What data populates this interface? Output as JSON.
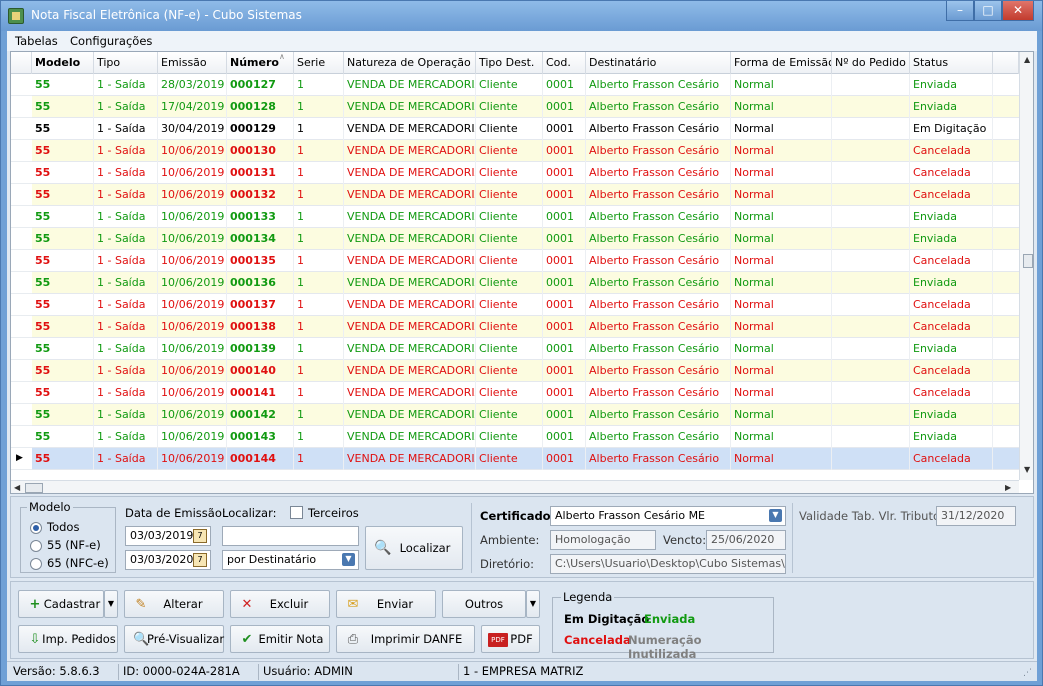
{
  "window": {
    "title": "Nota Fiscal Eletrônica (NF-e) - Cubo Sistemas",
    "min": "–",
    "max": "□",
    "close": "✕"
  },
  "menu": [
    "Tabelas",
    "Configurações"
  ],
  "grid": {
    "columns": [
      "Modelo",
      "Tipo",
      "Emissão",
      "Número",
      "Serie",
      "Natureza de Operação",
      "Tipo Dest.",
      "Cod.",
      "Destinatário",
      "Forma de Emissão",
      "Nº do Pedido",
      "Status"
    ],
    "sort_indicator": "∧",
    "rows": [
      {
        "modelo": "55",
        "tipo": "1 - Saída",
        "emissao": "28/03/2019",
        "numero": "000127",
        "serie": "1",
        "natureza": "VENDA DE MERCADORIA",
        "tipo_dest": "Cliente",
        "cod": "0001",
        "destinatario": "Alberto Frasson Cesário",
        "forma": "Normal",
        "pedido": "",
        "status": "Enviada"
      },
      {
        "modelo": "55",
        "tipo": "1 - Saída",
        "emissao": "17/04/2019",
        "numero": "000128",
        "serie": "1",
        "natureza": "VENDA DE MERCADORIA",
        "tipo_dest": "Cliente",
        "cod": "0001",
        "destinatario": "Alberto Frasson Cesário",
        "forma": "Normal",
        "pedido": "",
        "status": "Enviada"
      },
      {
        "modelo": "55",
        "tipo": "1 - Saída",
        "emissao": "30/04/2019",
        "numero": "000129",
        "serie": "1",
        "natureza": "VENDA DE MERCADORIA",
        "tipo_dest": "Cliente",
        "cod": "0001",
        "destinatario": "Alberto Frasson Cesário",
        "forma": "Normal",
        "pedido": "",
        "status": "Em Digitação"
      },
      {
        "modelo": "55",
        "tipo": "1 - Saída",
        "emissao": "10/06/2019",
        "numero": "000130",
        "serie": "1",
        "natureza": "VENDA DE MERCADORIA",
        "tipo_dest": "Cliente",
        "cod": "0001",
        "destinatario": "Alberto Frasson Cesário",
        "forma": "Normal",
        "pedido": "",
        "status": "Cancelada"
      },
      {
        "modelo": "55",
        "tipo": "1 - Saída",
        "emissao": "10/06/2019",
        "numero": "000131",
        "serie": "1",
        "natureza": "VENDA DE MERCADORIA",
        "tipo_dest": "Cliente",
        "cod": "0001",
        "destinatario": "Alberto Frasson Cesário",
        "forma": "Normal",
        "pedido": "",
        "status": "Cancelada"
      },
      {
        "modelo": "55",
        "tipo": "1 - Saída",
        "emissao": "10/06/2019",
        "numero": "000132",
        "serie": "1",
        "natureza": "VENDA DE MERCADORIA",
        "tipo_dest": "Cliente",
        "cod": "0001",
        "destinatario": "Alberto Frasson Cesário",
        "forma": "Normal",
        "pedido": "",
        "status": "Cancelada"
      },
      {
        "modelo": "55",
        "tipo": "1 - Saída",
        "emissao": "10/06/2019",
        "numero": "000133",
        "serie": "1",
        "natureza": "VENDA DE MERCADORIA",
        "tipo_dest": "Cliente",
        "cod": "0001",
        "destinatario": "Alberto Frasson Cesário",
        "forma": "Normal",
        "pedido": "",
        "status": "Enviada"
      },
      {
        "modelo": "55",
        "tipo": "1 - Saída",
        "emissao": "10/06/2019",
        "numero": "000134",
        "serie": "1",
        "natureza": "VENDA DE MERCADORIA",
        "tipo_dest": "Cliente",
        "cod": "0001",
        "destinatario": "Alberto Frasson Cesário",
        "forma": "Normal",
        "pedido": "",
        "status": "Enviada"
      },
      {
        "modelo": "55",
        "tipo": "1 - Saída",
        "emissao": "10/06/2019",
        "numero": "000135",
        "serie": "1",
        "natureza": "VENDA DE MERCADORIA",
        "tipo_dest": "Cliente",
        "cod": "0001",
        "destinatario": "Alberto Frasson Cesário",
        "forma": "Normal",
        "pedido": "",
        "status": "Cancelada"
      },
      {
        "modelo": "55",
        "tipo": "1 - Saída",
        "emissao": "10/06/2019",
        "numero": "000136",
        "serie": "1",
        "natureza": "VENDA DE MERCADORIA",
        "tipo_dest": "Cliente",
        "cod": "0001",
        "destinatario": "Alberto Frasson Cesário",
        "forma": "Normal",
        "pedido": "",
        "status": "Enviada"
      },
      {
        "modelo": "55",
        "tipo": "1 - Saída",
        "emissao": "10/06/2019",
        "numero": "000137",
        "serie": "1",
        "natureza": "VENDA DE MERCADORIA",
        "tipo_dest": "Cliente",
        "cod": "0001",
        "destinatario": "Alberto Frasson Cesário",
        "forma": "Normal",
        "pedido": "",
        "status": "Cancelada"
      },
      {
        "modelo": "55",
        "tipo": "1 - Saída",
        "emissao": "10/06/2019",
        "numero": "000138",
        "serie": "1",
        "natureza": "VENDA DE MERCADORIA",
        "tipo_dest": "Cliente",
        "cod": "0001",
        "destinatario": "Alberto Frasson Cesário",
        "forma": "Normal",
        "pedido": "",
        "status": "Cancelada"
      },
      {
        "modelo": "55",
        "tipo": "1 - Saída",
        "emissao": "10/06/2019",
        "numero": "000139",
        "serie": "1",
        "natureza": "VENDA DE MERCADORIA",
        "tipo_dest": "Cliente",
        "cod": "0001",
        "destinatario": "Alberto Frasson Cesário",
        "forma": "Normal",
        "pedido": "",
        "status": "Enviada"
      },
      {
        "modelo": "55",
        "tipo": "1 - Saída",
        "emissao": "10/06/2019",
        "numero": "000140",
        "serie": "1",
        "natureza": "VENDA DE MERCADORIA",
        "tipo_dest": "Cliente",
        "cod": "0001",
        "destinatario": "Alberto Frasson Cesário",
        "forma": "Normal",
        "pedido": "",
        "status": "Cancelada"
      },
      {
        "modelo": "55",
        "tipo": "1 - Saída",
        "emissao": "10/06/2019",
        "numero": "000141",
        "serie": "1",
        "natureza": "VENDA DE MERCADORIA",
        "tipo_dest": "Cliente",
        "cod": "0001",
        "destinatario": "Alberto Frasson Cesário",
        "forma": "Normal",
        "pedido": "",
        "status": "Cancelada"
      },
      {
        "modelo": "55",
        "tipo": "1 - Saída",
        "emissao": "10/06/2019",
        "numero": "000142",
        "serie": "1",
        "natureza": "VENDA DE MERCADORIA",
        "tipo_dest": "Cliente",
        "cod": "0001",
        "destinatario": "Alberto Frasson Cesário",
        "forma": "Normal",
        "pedido": "",
        "status": "Enviada"
      },
      {
        "modelo": "55",
        "tipo": "1 - Saída",
        "emissao": "10/06/2019",
        "numero": "000143",
        "serie": "1",
        "natureza": "VENDA DE MERCADORIA",
        "tipo_dest": "Cliente",
        "cod": "0001",
        "destinatario": "Alberto Frasson Cesário",
        "forma": "Normal",
        "pedido": "",
        "status": "Enviada"
      },
      {
        "modelo": "55",
        "tipo": "1 - Saída",
        "emissao": "10/06/2019",
        "numero": "000144",
        "serie": "1",
        "natureza": "VENDA DE MERCADORIA",
        "tipo_dest": "Cliente",
        "cod": "0001",
        "destinatario": "Alberto Frasson Cesário",
        "forma": "Normal",
        "pedido": "",
        "status": "Cancelada"
      }
    ],
    "selected_row": 17,
    "row_pointer": "▶"
  },
  "filters": {
    "modelo_label": "Modelo",
    "modelo_options": [
      "Todos",
      "55 (NF-e)",
      "65 (NFC-e)"
    ],
    "data_emissao_label": "Data de Emissão:",
    "date_from": "03/03/2019",
    "date_to": "03/03/2020",
    "localizar_label": "Localizar:",
    "localizar_value": "",
    "terceiros_label": "Terceiros",
    "localizar_por": "por Destinatário",
    "localizar_button": "Localizar",
    "certificado_label": "Certificado:",
    "certificado_value": "Alberto Frasson Cesário ME",
    "ambiente_label": "Ambiente:",
    "ambiente_value": "Homologação",
    "vencto_label": "Vencto:",
    "vencto_value": "25/06/2020",
    "diretorio_label": "Diretório:",
    "diretorio_value": "C:\\Users\\Usuario\\Desktop\\Cubo Sistemas\\NFe E",
    "validade_label": "Validade Tab. Vlr. Tributos:",
    "validade_value": "31/12/2020"
  },
  "toolbar": {
    "cadastrar": "Cadastrar",
    "alterar": "Alterar",
    "excluir": "Excluir",
    "enviar": "Enviar",
    "outros": "Outros",
    "imp_pedidos": "Imp. Pedidos",
    "pre_visualizar": "Pré-Visualizar",
    "emitir_nota": "Emitir Nota",
    "imprimir_danfe": "Imprimir DANFE",
    "pdf": "PDF",
    "pdf_icon_text": "PDF"
  },
  "legend": {
    "title": "Legenda",
    "em_digitacao": "Em Digitação",
    "enviada": "Enviada",
    "cancelada": "Cancelada",
    "inutilizada": "Numeração Inutilizada"
  },
  "statusbar": {
    "versao": "Versão: 5.8.6.3",
    "id": "ID: 0000-024A-281A",
    "usuario": "Usuário: ADMIN",
    "empresa": "1 - EMPRESA MATRIZ"
  },
  "colors": {
    "enviada": "#119a11",
    "cancelada": "#e01010",
    "em_digitacao": "#000000",
    "inutilizada": "#808080"
  }
}
